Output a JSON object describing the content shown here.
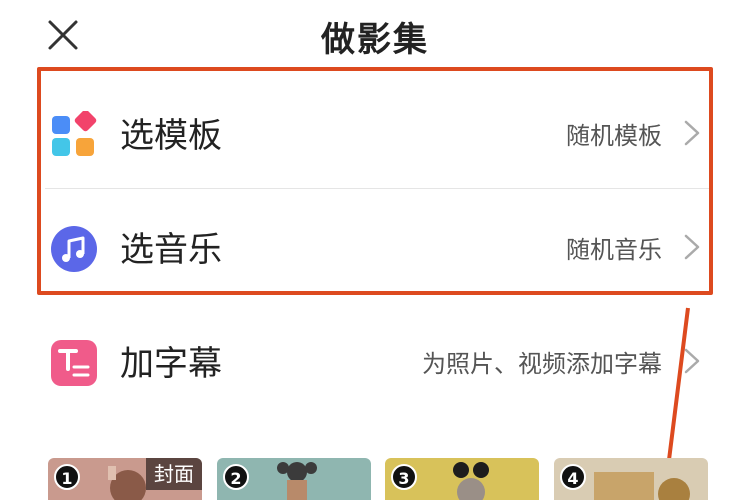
{
  "header": {
    "title": "做影集",
    "close_icon": "close-icon"
  },
  "rows": {
    "template": {
      "label": "选模板",
      "value": "随机模板",
      "icon": "template-grid-icon"
    },
    "music": {
      "label": "选音乐",
      "value": "随机音乐",
      "icon": "music-note-icon"
    },
    "subtitle": {
      "label": "加字幕",
      "value": "为照片、视频添加字幕",
      "icon": "subtitle-icon"
    }
  },
  "thumbnails": [
    {
      "number": "1",
      "tag": "封面"
    },
    {
      "number": "2"
    },
    {
      "number": "3"
    },
    {
      "number": "4"
    }
  ],
  "colors": {
    "highlight": "#dd4a1f",
    "music_icon_bg": "#5b67e8",
    "subtitle_icon_bg": "#f05b8a",
    "tpl_red": "#f2436b",
    "tpl_blue": "#4b8df7",
    "tpl_cyan": "#43c6e8",
    "tpl_orange": "#f7a43a"
  }
}
